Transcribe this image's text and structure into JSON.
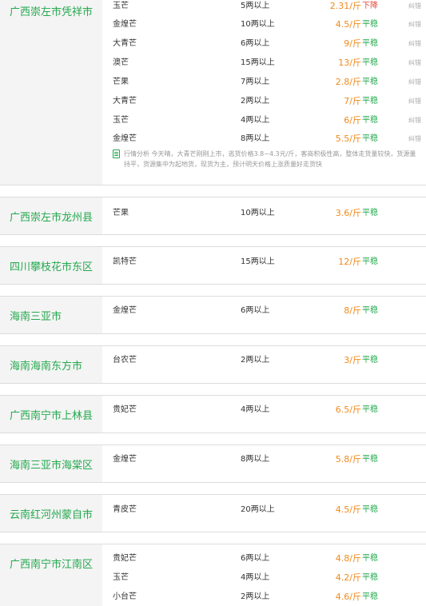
{
  "regions": [
    {
      "name": "广西崇左市凭祥市",
      "analysis": "行情分析 今天晴，大青芒刚刚上市，逃货价格3.8~4.3元/斤，客商积极性高，整体走货量较快，货源量持平，货源集中为起地货，现货为主，预计明天价格上涨质量好走货快",
      "rows": [
        {
          "variety": "玉芒",
          "spec": "5两以上",
          "price": "2.31/斤",
          "trend": "下降",
          "fix": "纠错"
        },
        {
          "variety": "金煌芒",
          "spec": "10两以上",
          "price": "4.5/斤",
          "trend": "平稳",
          "fix": "纠错"
        },
        {
          "variety": "大青芒",
          "spec": "6两以上",
          "price": "9/斤",
          "trend": "平稳",
          "fix": "纠错"
        },
        {
          "variety": "澳芒",
          "spec": "15两以上",
          "price": "13/斤",
          "trend": "平稳",
          "fix": "纠错"
        },
        {
          "variety": "芒果",
          "spec": "7两以上",
          "price": "2.8/斤",
          "trend": "平稳",
          "fix": "纠错"
        },
        {
          "variety": "大青芒",
          "spec": "2两以上",
          "price": "7/斤",
          "trend": "平稳",
          "fix": "纠错"
        },
        {
          "variety": "玉芒",
          "spec": "4两以上",
          "price": "6/斤",
          "trend": "平稳",
          "fix": "纠错"
        },
        {
          "variety": "金煌芒",
          "spec": "8两以上",
          "price": "5.5/斤",
          "trend": "平稳",
          "fix": "纠错"
        }
      ]
    },
    {
      "name": "广西崇左市龙州县",
      "rows": [
        {
          "variety": "芒果",
          "spec": "10两以上",
          "price": "3.6/斤",
          "trend": "平稳"
        }
      ]
    },
    {
      "name": "四川攀枝花市东区",
      "rows": [
        {
          "variety": "凯特芒",
          "spec": "15两以上",
          "price": "12/斤",
          "trend": "平稳"
        }
      ]
    },
    {
      "name": "海南三亚市",
      "rows": [
        {
          "variety": "金煌芒",
          "spec": "6两以上",
          "price": "8/斤",
          "trend": "平稳"
        }
      ]
    },
    {
      "name": "海南海南东方市",
      "rows": [
        {
          "variety": "台农芒",
          "spec": "2两以上",
          "price": "3/斤",
          "trend": "平稳"
        }
      ]
    },
    {
      "name": "广西南宁市上林县",
      "rows": [
        {
          "variety": "贵妃芒",
          "spec": "4两以上",
          "price": "6.5/斤",
          "trend": "平稳"
        }
      ]
    },
    {
      "name": "海南三亚市海棠区",
      "rows": [
        {
          "variety": "金煌芒",
          "spec": "8两以上",
          "price": "5.8/斤",
          "trend": "平稳"
        }
      ]
    },
    {
      "name": "云南红河州蒙自市",
      "rows": [
        {
          "variety": "青皮芒",
          "spec": "20两以上",
          "price": "4.5/斤",
          "trend": "平稳"
        }
      ]
    },
    {
      "name": "广西南宁市江南区",
      "rows": [
        {
          "variety": "贵妃芒",
          "spec": "6两以上",
          "price": "4.8/斤",
          "trend": "平稳"
        },
        {
          "variety": "玉芒",
          "spec": "4两以上",
          "price": "4.2/斤",
          "trend": "平稳"
        },
        {
          "variety": "小台芒",
          "spec": "2两以上",
          "price": "4.6/斤",
          "trend": "平稳"
        }
      ]
    }
  ]
}
